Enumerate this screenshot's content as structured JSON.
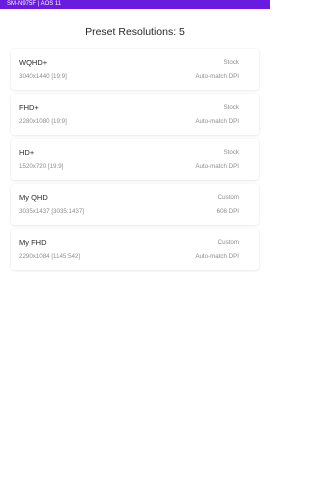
{
  "status_bar": {
    "text": "SM-N975F | AOS 11"
  },
  "page": {
    "title": "Preset Resolutions: 5"
  },
  "presets": [
    {
      "name": "WQHD+",
      "resolution": "3040x1440 [19:9]",
      "type": "Stock",
      "dpi": "Auto-match DPI"
    },
    {
      "name": "FHD+",
      "resolution": "2280x1080 [19:9]",
      "type": "Stock",
      "dpi": "Auto-match DPI"
    },
    {
      "name": "HD+",
      "resolution": "1520x720 [19:9]",
      "type": "Stock",
      "dpi": "Auto-match DPI"
    },
    {
      "name": "My QHD",
      "resolution": "3035x1437 [3035:1437]",
      "type": "Custom",
      "dpi": "608 DPI"
    },
    {
      "name": "My FHD",
      "resolution": "2290x1084 [1145:542]",
      "type": "Custom",
      "dpi": "Auto-match DPI"
    }
  ],
  "colors": {
    "status_bar": "#6a1be0",
    "background": "#ffffff"
  }
}
